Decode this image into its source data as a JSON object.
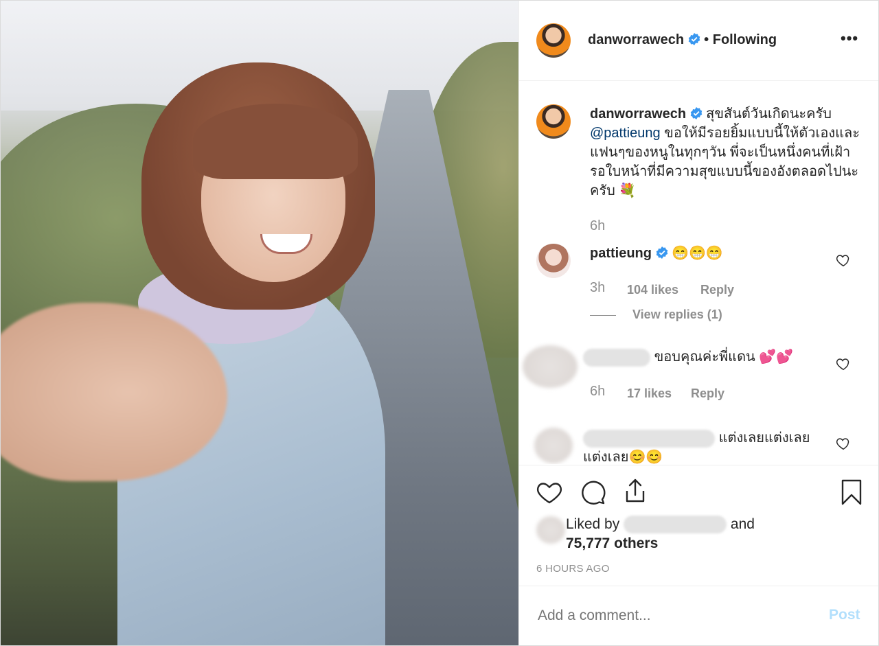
{
  "post": {
    "username": "danworrawech",
    "separator": "•",
    "follow_status": "Following",
    "more_label": "•••"
  },
  "caption": {
    "username": "danworrawech",
    "text_start": "สุขสันต์วันเกิดนะครับ",
    "mention": "@pattieung",
    "text_end": "ขอให้มีรอยยิ้มแบบนี้ให้ตัวเองและแฟนๆของหนูในทุกๆวัน พี่จะเป็นหนึ่งคนที่เฝ้ารอใบหน้าที่มีความสุขแบบนี้ของอังตลอดไปนะครับ 💐",
    "time": "6h"
  },
  "comments": [
    {
      "username": "pattieung",
      "text": "😁😁😁",
      "time": "3h",
      "likes": "104 likes",
      "reply": "Reply",
      "view_replies": "View replies (1)"
    },
    {
      "text": "ขอบคุณค่ะพี่แดน 💕💕",
      "time": "6h",
      "likes": "17 likes",
      "reply": "Reply"
    },
    {
      "text": "แต่งเลยแต่งเลยแต่งเลย😊😊"
    }
  ],
  "likes": {
    "prefix": "Liked by",
    "and": "and",
    "others": "75,777 others"
  },
  "timestamp": "6 HOURS AGO",
  "comment_box": {
    "placeholder": "Add a comment...",
    "post_label": "Post"
  },
  "colors": {
    "verified": "#3897f0",
    "mention": "#00376b",
    "post_disabled": "#b2dffc",
    "secondary_text": "#8e8e8e"
  }
}
